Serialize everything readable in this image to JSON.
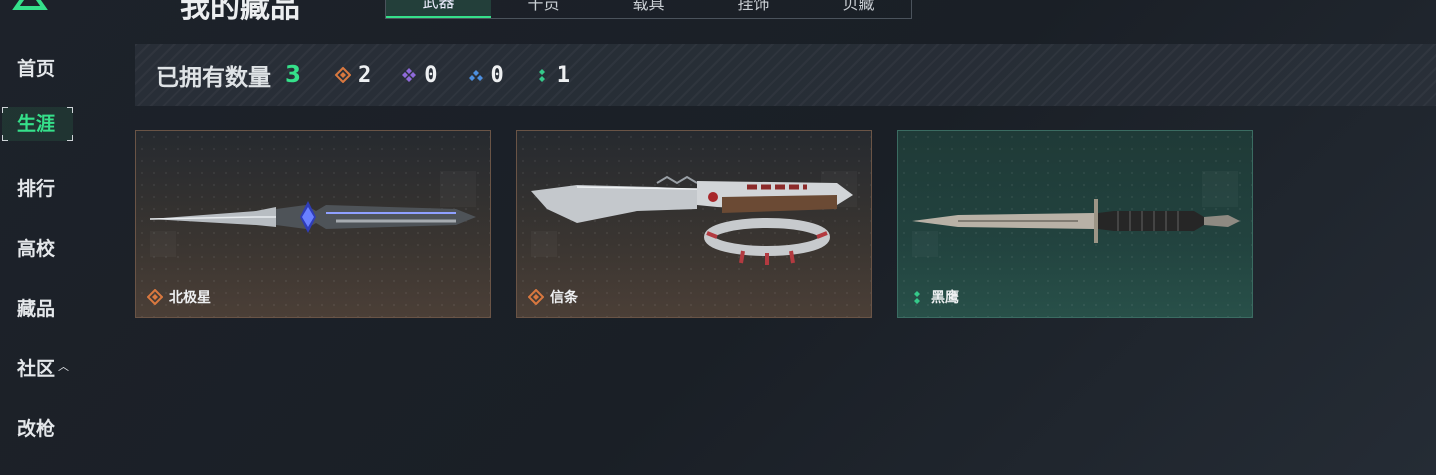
{
  "sidebar": {
    "items": [
      {
        "label": "首页"
      },
      {
        "label": "生涯"
      },
      {
        "label": "排行"
      },
      {
        "label": "高校"
      },
      {
        "label": "藏品"
      },
      {
        "label": "社区"
      },
      {
        "label": "改枪"
      }
    ]
  },
  "header": {
    "title": "我的藏品",
    "tabs": [
      {
        "label": "武器"
      },
      {
        "label": "干员"
      },
      {
        "label": "载具"
      },
      {
        "label": "挂饰"
      },
      {
        "label": "贝藏"
      }
    ]
  },
  "stats": {
    "label": "已拥有数量",
    "total": "3",
    "items": [
      {
        "icon": "orange-diamond-icon",
        "color": "#d9783f",
        "count": "2"
      },
      {
        "icon": "purple-diamond-icon",
        "color": "#8f6ad9",
        "count": "0"
      },
      {
        "icon": "blue-diamond-icon",
        "color": "#4d8fe0",
        "count": "0"
      },
      {
        "icon": "green-dots-icon",
        "color": "#35c98a",
        "count": "1"
      }
    ]
  },
  "cards": [
    {
      "name": "北极星",
      "rarity": "orange",
      "rarity_icon": "orange-diamond-icon"
    },
    {
      "name": "信条",
      "rarity": "orange",
      "rarity_icon": "orange-diamond-icon"
    },
    {
      "name": "黑鹰",
      "rarity": "teal",
      "rarity_icon": "green-dots-icon"
    }
  ],
  "colors": {
    "accent": "#35e08a",
    "orange": "#d9783f",
    "purple": "#8f6ad9",
    "blue": "#4d8fe0",
    "green": "#35c98a"
  }
}
